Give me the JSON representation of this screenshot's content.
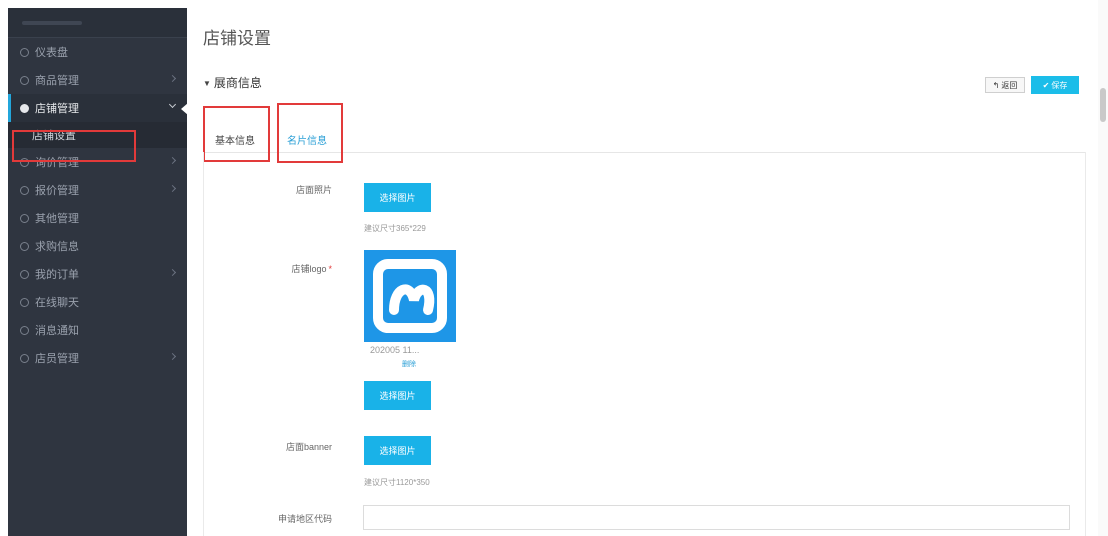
{
  "sidebar": {
    "items": [
      {
        "label": "仪表盘",
        "has_arrow": false
      },
      {
        "label": "商品管理",
        "has_arrow": true
      },
      {
        "label": "店铺管理",
        "has_arrow": true,
        "active": true
      },
      {
        "label": "店铺设置",
        "sub": true
      },
      {
        "label": "询价管理",
        "has_arrow": true
      },
      {
        "label": "报价管理",
        "has_arrow": true
      },
      {
        "label": "其他管理",
        "has_arrow": false
      },
      {
        "label": "求购信息",
        "has_arrow": false
      },
      {
        "label": "我的订单",
        "has_arrow": true
      },
      {
        "label": "在线聊天",
        "has_arrow": false
      },
      {
        "label": "消息通知",
        "has_arrow": false
      },
      {
        "label": "店员管理",
        "has_arrow": true
      }
    ]
  },
  "header": {
    "page_title": "店铺设置",
    "section_title": "展商信息",
    "back_label": "返回",
    "save_label": "保存"
  },
  "tabs": [
    {
      "label": "基本信息"
    },
    {
      "label": "名片信息"
    }
  ],
  "form": {
    "shop_photo": {
      "label": "店面照片",
      "button": "选择图片",
      "hint": "建议尺寸365*229"
    },
    "shop_logo": {
      "label": "店铺logo",
      "required_mark": "*",
      "button": "选择图片",
      "file_name": "202005 11...",
      "delete_label": "删除"
    },
    "shop_banner": {
      "label": "店面banner",
      "button": "选择图片",
      "hint": "建议尺寸1120*350"
    },
    "region_code": {
      "label": "申请地区代码",
      "value": ""
    }
  },
  "colors": {
    "sidebar_bg": "#2f3540",
    "accent": "#19b2e8",
    "highlight": "#e23a3a",
    "logo_bg": "#1e96e7"
  }
}
